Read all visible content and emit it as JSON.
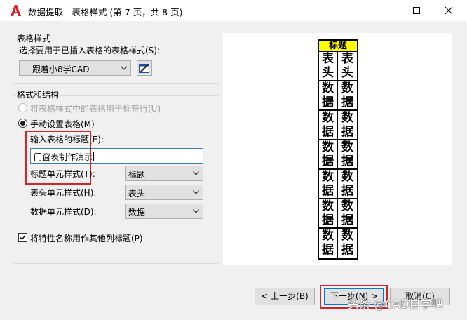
{
  "window": {
    "title": "数据提取 - 表格样式 (第 7 页，共 8 页)"
  },
  "table_style_group": {
    "legend": "表格样式",
    "prompt": "选择要用于已插入表格的表格样式(S):",
    "selected_style": "跟着小8学CAD"
  },
  "format_group": {
    "legend": "格式和结构",
    "option_use_style": "将表格样式中的表格用于标签行(U)",
    "option_manual": "手动设置表格(M)",
    "title_prompt": "输入表格的标题(E):",
    "title_value": "门窗表制作演示",
    "title_cell_label": "标题单元样式(T):",
    "title_cell_value": "标题",
    "header_cell_label": "表头单元样式(H):",
    "header_cell_value": "表头",
    "data_cell_label": "数据单元样式(D):",
    "data_cell_value": "数据",
    "use_property_names": "将特性名称用作其他列标题(P)"
  },
  "preview": {
    "title": "标题",
    "header": [
      "表",
      "头"
    ],
    "data": [
      "数",
      "据"
    ],
    "data_rows": 6
  },
  "buttons": {
    "back": "< 上一步(B)",
    "next": "下一步(N) >",
    "cancel": "取消(C)"
  },
  "watermark": {
    "text": "头条 @CAD自学吧"
  }
}
